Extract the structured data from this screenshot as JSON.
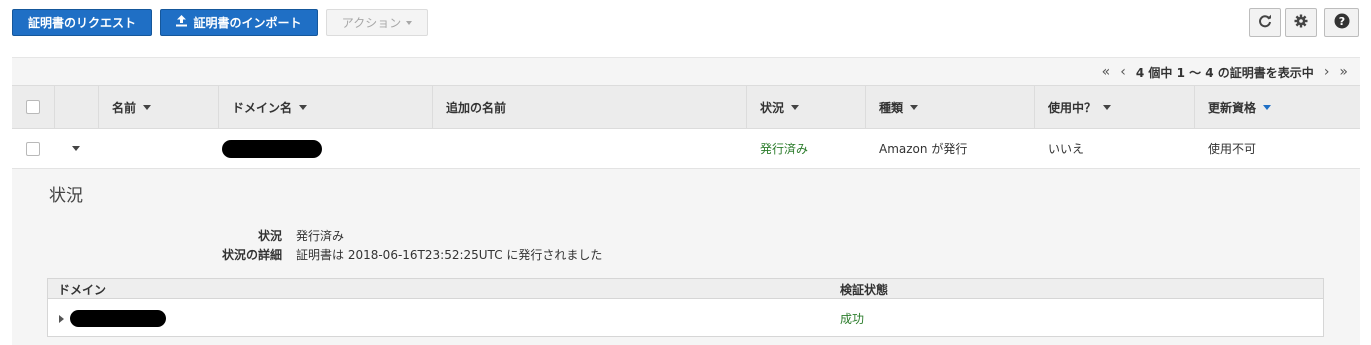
{
  "toolbar": {
    "request_label": "証明書のリクエスト",
    "import_label": "証明書のインポート",
    "actions_label": "アクション",
    "refresh_icon": "refresh-icon",
    "settings_icon": "gear-icon",
    "help_icon": "help-icon"
  },
  "pager": {
    "first": "«",
    "prev": "‹",
    "text": "4 個中 1 〜 4 の証明書を表示中",
    "next": "›",
    "last": "»"
  },
  "columns": {
    "name": "名前",
    "domain": "ドメイン名",
    "additional": "追加の名前",
    "status": "状況",
    "type": "種類",
    "in_use": "使用中？",
    "renewal": "更新資格"
  },
  "row": {
    "status": "発行済み",
    "type": "Amazon が発行",
    "in_use": "いいえ",
    "renewal": "使用不可"
  },
  "detail": {
    "title": "状況",
    "status_label": "状況",
    "status_value": "発行済み",
    "detail_label": "状況の詳細",
    "detail_value": "証明書は 2018-06-16T23:52:25UTC に発行されました",
    "domain_header": "ドメイン",
    "validation_header": "検証状態",
    "validation_value": "成功"
  },
  "colors": {
    "primary": "#1f6fc5",
    "success": "#2b7c2b"
  }
}
